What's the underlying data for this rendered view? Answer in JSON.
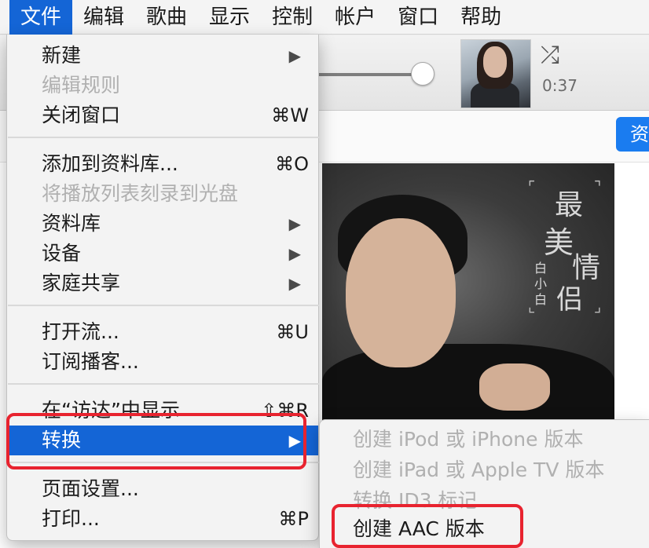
{
  "menubar": {
    "items": [
      {
        "label": "文件",
        "active": true
      },
      {
        "label": "编辑"
      },
      {
        "label": "歌曲"
      },
      {
        "label": "显示"
      },
      {
        "label": "控制"
      },
      {
        "label": "帐户"
      },
      {
        "label": "窗口"
      },
      {
        "label": "帮助"
      }
    ]
  },
  "player": {
    "elapsed": "0:37",
    "shuffle_icon": "shuffle-icon"
  },
  "library_button": "资",
  "album_art": {
    "title_chars": [
      "最",
      "美",
      "情",
      "侣"
    ],
    "artist_chars": [
      "白",
      "小",
      "白"
    ]
  },
  "file_menu": {
    "items": [
      {
        "label": "新建",
        "submenu": true,
        "arrow": "▶"
      },
      {
        "label": "编辑规则",
        "disabled": true
      },
      {
        "label": "关闭窗口",
        "shortcut": "⌘W"
      },
      {
        "label": "添加到资料库...",
        "shortcut": "⌘O"
      },
      {
        "label": "将播放列表刻录到光盘",
        "disabled": true
      },
      {
        "label": "资料库",
        "submenu": true,
        "arrow": "▶"
      },
      {
        "label": "设备",
        "submenu": true,
        "arrow": "▶"
      },
      {
        "label": "家庭共享",
        "submenu": true,
        "arrow": "▶"
      },
      {
        "label": "打开流...",
        "shortcut": "⌘U"
      },
      {
        "label": "订阅播客..."
      },
      {
        "label": "在“访达”中显示",
        "shortcut": "⇧⌘R"
      },
      {
        "label": "转换",
        "submenu": true,
        "highlighted": true,
        "arrow": "▶"
      },
      {
        "label": "页面设置..."
      },
      {
        "label": "打印...",
        "shortcut": "⌘P"
      }
    ]
  },
  "convert_submenu": {
    "items": [
      {
        "label": "创建 iPod 或 iPhone 版本",
        "disabled": true
      },
      {
        "label": "创建 iPad 或 Apple TV 版本",
        "disabled": true
      },
      {
        "label": "转换 ID3 标记",
        "disabled": true
      },
      {
        "label": "创建 AAC 版本"
      }
    ]
  },
  "colors": {
    "highlight": "#1465d6",
    "annotation": "#e8232f"
  }
}
